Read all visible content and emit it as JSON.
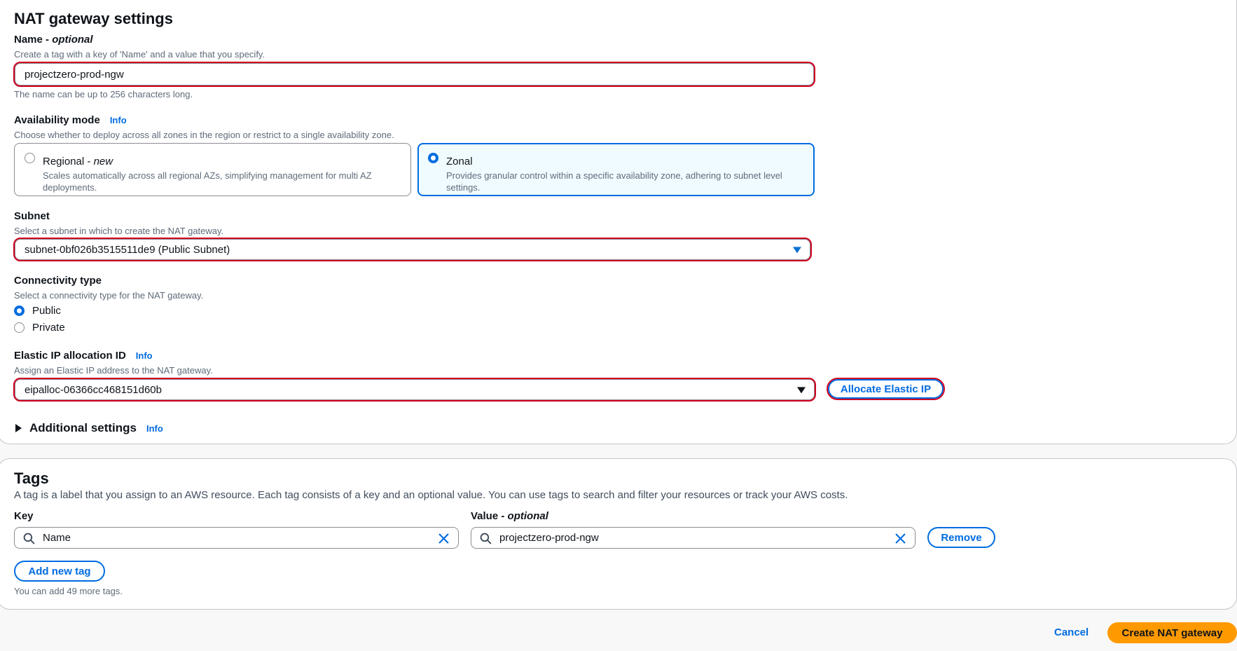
{
  "nat_settings": {
    "title": "NAT gateway settings",
    "name": {
      "label": "Name",
      "label_suffix": "optional",
      "description": "Create a tag with a key of 'Name' and a value that you specify.",
      "value": "projectzero-prod-ngw",
      "constraint": "The name can be up to 256 characters long."
    },
    "availability": {
      "label": "Availability mode",
      "info": "Info",
      "description": "Choose whether to deploy across all zones in the region or restrict to a single availability zone.",
      "options": [
        {
          "title": "Regional",
          "badge": "new",
          "desc_line1": "Scales automatically across all regional AZs, simplifying management for multi AZ",
          "desc_line2": "deployments.",
          "selected": false
        },
        {
          "title": "Zonal",
          "desc_line1": "Provides granular control within a specific availability zone, adhering to subnet level",
          "desc_line2": "settings.",
          "selected": true
        }
      ]
    },
    "subnet": {
      "label": "Subnet",
      "description": "Select a subnet in which to create the NAT gateway.",
      "value": "subnet-0bf026b3515511de9 (Public Subnet)"
    },
    "connectivity": {
      "label": "Connectivity type",
      "description": "Select a connectivity type for the NAT gateway.",
      "options": [
        {
          "label": "Public",
          "selected": true
        },
        {
          "label": "Private",
          "selected": false
        }
      ]
    },
    "eip": {
      "label": "Elastic IP allocation ID",
      "info": "Info",
      "description": "Assign an Elastic IP address to the NAT gateway.",
      "value": "eipalloc-06366cc468151d60b",
      "allocate_label": "Allocate Elastic IP"
    },
    "additional": {
      "label": "Additional settings",
      "info": "Info"
    }
  },
  "tags": {
    "title": "Tags",
    "description": "A tag is a label that you assign to an AWS resource. Each tag consists of a key and an optional value. You can use tags to search and filter your resources or track your AWS costs.",
    "key_label": "Key",
    "value_label": "Value",
    "value_label_suffix": "optional",
    "rows": [
      {
        "key": "Name",
        "value": "projectzero-prod-ngw"
      }
    ],
    "remove_label": "Remove",
    "add_label": "Add new tag",
    "remaining": "You can add 49 more tags."
  },
  "footer": {
    "cancel_label": "Cancel",
    "create_label": "Create NAT gateway"
  },
  "colors": {
    "accent": "#006ce0",
    "primary_button": "#ff9900",
    "highlight_outline": "#d1001f"
  }
}
